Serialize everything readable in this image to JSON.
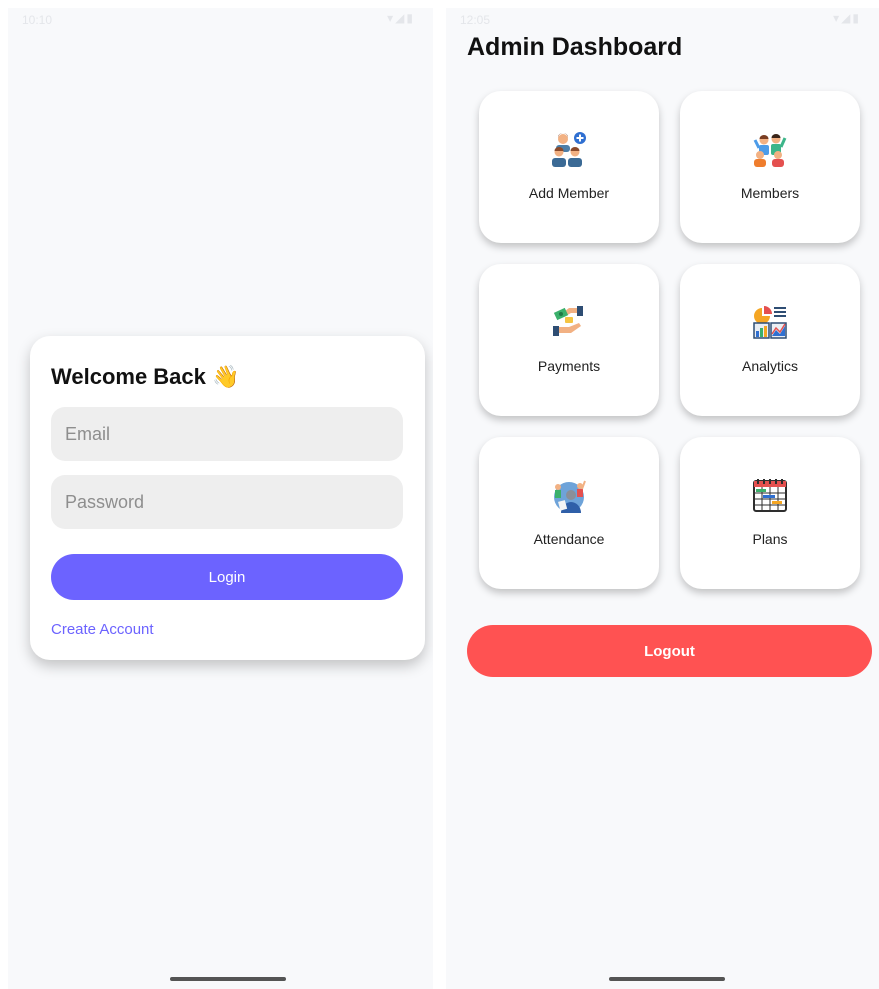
{
  "login_screen": {
    "status": {
      "time": "10:10",
      "icons": "▾◢▮"
    },
    "title": "Welcome Back 👋",
    "email": {
      "placeholder": "Email",
      "value": ""
    },
    "password": {
      "placeholder": "Password",
      "value": ""
    },
    "login_label": "Login",
    "create_account_label": "Create Account"
  },
  "dashboard_screen": {
    "status": {
      "time": "12:05",
      "icons": "▾◢▮"
    },
    "title": "Admin Dashboard",
    "tiles": [
      {
        "label": "Add Member",
        "icon": "add-member-icon"
      },
      {
        "label": "Members",
        "icon": "members-icon"
      },
      {
        "label": "Payments",
        "icon": "payments-icon"
      },
      {
        "label": "Analytics",
        "icon": "analytics-icon"
      },
      {
        "label": "Attendance",
        "icon": "attendance-icon"
      },
      {
        "label": "Plans",
        "icon": "plans-icon"
      }
    ],
    "logout_label": "Logout"
  },
  "colors": {
    "primary": "#6c63ff",
    "danger": "#ff5252",
    "background": "#f8f9fb",
    "card": "#ffffff",
    "input": "#eeeeee"
  }
}
